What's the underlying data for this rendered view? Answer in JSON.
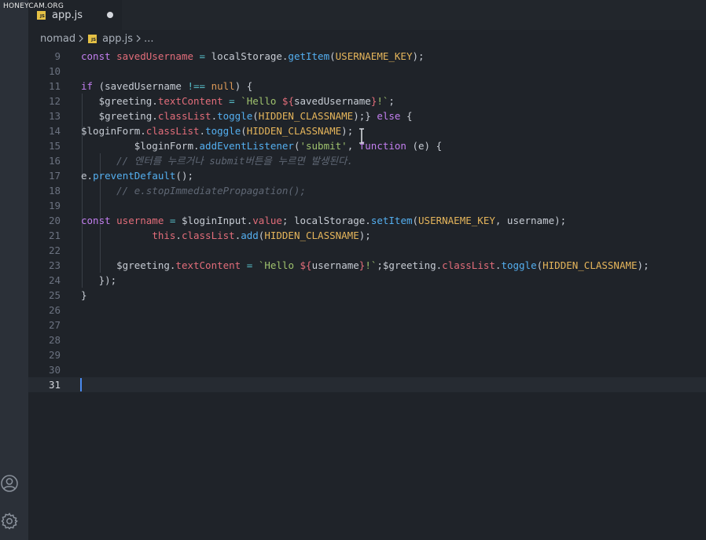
{
  "watermark": "HONEYCAM.ORG",
  "tab": {
    "label": "app.js",
    "badge": "JS"
  },
  "breadcrumb": {
    "folder": "nomad",
    "file": "app.js",
    "ellipsis": "..."
  },
  "icons": {
    "account": "account-icon",
    "settings": "gear-icon",
    "chevron": "chevron-right-icon",
    "js_file": "js-file-icon",
    "unsaved": "unsaved-dot-icon"
  },
  "colors": {
    "background": "#1f2329",
    "activity_bar": "#2b3038",
    "keyword": "#c37ff0",
    "variable": "#e26d7a",
    "function": "#54aff0",
    "string": "#9fc26d",
    "constant": "#e5b55b",
    "comment": "#5f6774",
    "cursor": "#4a8bf0"
  },
  "editor": {
    "active_line": "31",
    "lines": [
      {
        "n": "9",
        "tokens": [
          [
            "kw",
            "const "
          ],
          [
            "var",
            "savedUsername"
          ],
          [
            "pl",
            " "
          ],
          [
            "op",
            "="
          ],
          [
            "pl",
            " localStorage."
          ],
          [
            "fn",
            "getItem"
          ],
          [
            "pl",
            "("
          ],
          [
            "const",
            "USERNAEME_KEY"
          ],
          [
            "pl",
            ");"
          ]
        ]
      },
      {
        "n": "10",
        "tokens": []
      },
      {
        "n": "11",
        "tokens": [
          [
            "kw",
            "if "
          ],
          [
            "pl",
            "(savedUsername "
          ],
          [
            "op",
            "!=="
          ],
          [
            "pl",
            " "
          ],
          [
            "num",
            "null"
          ],
          [
            "pl",
            ") {"
          ]
        ]
      },
      {
        "n": "12",
        "tokens": [
          [
            "pl",
            "   $greeting."
          ],
          [
            "var",
            "textContent"
          ],
          [
            "pl",
            " "
          ],
          [
            "op",
            "="
          ],
          [
            "pl",
            " "
          ],
          [
            "str",
            "`Hello "
          ],
          [
            "var",
            "${"
          ],
          [
            "pl",
            "savedUsername"
          ],
          [
            "var",
            "}"
          ],
          [
            "str",
            "!`"
          ],
          [
            "pl",
            ";"
          ]
        ]
      },
      {
        "n": "13",
        "tokens": [
          [
            "pl",
            "   $greeting."
          ],
          [
            "var",
            "classList"
          ],
          [
            "pl",
            "."
          ],
          [
            "fn",
            "toggle"
          ],
          [
            "pl",
            "("
          ],
          [
            "const",
            "HIDDEN_CLASSNAME"
          ],
          [
            "pl",
            ");} "
          ],
          [
            "kw",
            "else"
          ],
          [
            "pl",
            " {"
          ]
        ]
      },
      {
        "n": "14",
        "tokens": [
          [
            "pl",
            "$loginForm."
          ],
          [
            "var",
            "classList"
          ],
          [
            "pl",
            "."
          ],
          [
            "fn",
            "toggle"
          ],
          [
            "pl",
            "("
          ],
          [
            "const",
            "HIDDEN_CLASSNAME"
          ],
          [
            "pl",
            ");"
          ]
        ]
      },
      {
        "n": "15",
        "tokens": [
          [
            "pl",
            "         $loginForm."
          ],
          [
            "fn",
            "addEventListener"
          ],
          [
            "pl",
            "("
          ],
          [
            "str",
            "'submit'"
          ],
          [
            "pl",
            ", "
          ],
          [
            "kw",
            "function"
          ],
          [
            "pl",
            " (e) {"
          ]
        ]
      },
      {
        "n": "16",
        "tokens": [
          [
            "cm",
            "      // 엔터를 누르거나 submit버튼을 누르면 발생된다."
          ]
        ]
      },
      {
        "n": "17",
        "tokens": [
          [
            "pl",
            "e."
          ],
          [
            "fn",
            "preventDefault"
          ],
          [
            "pl",
            "();"
          ]
        ]
      },
      {
        "n": "18",
        "tokens": [
          [
            "cm",
            "      // e.stopImmediatePropagation();"
          ]
        ]
      },
      {
        "n": "19",
        "tokens": []
      },
      {
        "n": "20",
        "tokens": [
          [
            "kw",
            "const "
          ],
          [
            "var",
            "username"
          ],
          [
            "pl",
            " "
          ],
          [
            "op",
            "="
          ],
          [
            "pl",
            " $loginInput."
          ],
          [
            "var",
            "value"
          ],
          [
            "pl",
            "; localStorage."
          ],
          [
            "fn",
            "setItem"
          ],
          [
            "pl",
            "("
          ],
          [
            "const",
            "USERNAEME_KEY"
          ],
          [
            "pl",
            ", username);"
          ]
        ]
      },
      {
        "n": "21",
        "tokens": [
          [
            "pl",
            "            "
          ],
          [
            "var",
            "this"
          ],
          [
            "pl",
            "."
          ],
          [
            "var",
            "classList"
          ],
          [
            "pl",
            "."
          ],
          [
            "fn",
            "add"
          ],
          [
            "pl",
            "("
          ],
          [
            "const",
            "HIDDEN_CLASSNAME"
          ],
          [
            "pl",
            ");"
          ]
        ]
      },
      {
        "n": "22",
        "tokens": []
      },
      {
        "n": "23",
        "tokens": [
          [
            "pl",
            "      $greeting."
          ],
          [
            "var",
            "textContent"
          ],
          [
            "pl",
            " "
          ],
          [
            "op",
            "="
          ],
          [
            "pl",
            " "
          ],
          [
            "str",
            "`Hello "
          ],
          [
            "var",
            "${"
          ],
          [
            "pl",
            "username"
          ],
          [
            "var",
            "}"
          ],
          [
            "str",
            "!`"
          ],
          [
            "pl",
            ";$greeting."
          ],
          [
            "var",
            "classList"
          ],
          [
            "pl",
            "."
          ],
          [
            "fn",
            "toggle"
          ],
          [
            "pl",
            "("
          ],
          [
            "const",
            "HIDDEN_CLASSNAME"
          ],
          [
            "pl",
            ");"
          ]
        ]
      },
      {
        "n": "24",
        "tokens": [
          [
            "pl",
            "   });"
          ]
        ]
      },
      {
        "n": "25",
        "tokens": [
          [
            "pl",
            "}"
          ]
        ]
      },
      {
        "n": "26",
        "tokens": []
      },
      {
        "n": "27",
        "tokens": []
      },
      {
        "n": "28",
        "tokens": []
      },
      {
        "n": "29",
        "tokens": []
      },
      {
        "n": "30",
        "tokens": []
      },
      {
        "n": "31",
        "tokens": []
      }
    ]
  }
}
